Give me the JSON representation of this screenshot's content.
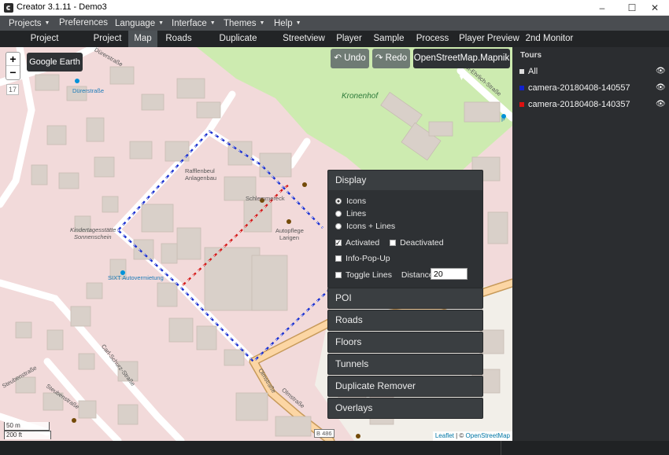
{
  "window": {
    "title": "Creator 3.1.11 - Demo3",
    "minimize": "–",
    "maximize": "☐",
    "close": "✕"
  },
  "menubar": [
    {
      "label": "Projects",
      "dropdown": true
    },
    {
      "label": "Preferences",
      "dropdown": false
    },
    {
      "label": "Language",
      "dropdown": true
    },
    {
      "label": "Interface",
      "dropdown": true
    },
    {
      "label": "Themes",
      "dropdown": true
    },
    {
      "label": "Help",
      "dropdown": true
    }
  ],
  "caret": "▼",
  "tabs": [
    {
      "label": "Project Management"
    },
    {
      "label": "Project"
    },
    {
      "label": "Map",
      "active": true
    },
    {
      "label": "Roads"
    },
    {
      "label": "Duplicate Remover"
    },
    {
      "label": "Streetview"
    },
    {
      "label": "Player"
    },
    {
      "label": "Sample"
    },
    {
      "label": "Process"
    },
    {
      "label": "Player Preview"
    },
    {
      "label": "2nd Monitor"
    }
  ],
  "map": {
    "zoom_in": "+",
    "zoom_out": "−",
    "zoom_level": "17",
    "google_earth": "Google Earth",
    "undo": "↶ Undo",
    "redo": "↷ Redo",
    "tile_layer": "OpenStreetMap.Mapnik ▾",
    "scale_metric": "50 m",
    "scale_imperial": "200 ft",
    "attribution_leaflet": "Leaflet",
    "attribution_sep": " | © ",
    "attribution_osm": "OpenStreetMap",
    "labels": {
      "kronenhof": "Kronenhof",
      "durerstrasse": "Dürerstraße",
      "durerstrasse2": "Dürerstraße",
      "rafflenbeul": "Rafflenbeul",
      "anlagenbau": "Anlagenbau",
      "schlemmer": "Schlemmereck",
      "autopflege": "Autopflege",
      "larigen": "Larigen",
      "kita1": "Kindertagesstätte",
      "kita2": "Sonnenschein",
      "sixt": "SIXT Autovermietung",
      "carl_schurz": "Carl-Schurz-Straße",
      "steuben": "Steubenstraße",
      "steuben2": "Steubenstraße",
      "olmstrasse": "Olmstraße",
      "olmstrasse2": "Olmstraße",
      "paul_ehrlich": "Paul-Ehrlich-Straße",
      "b486": "B 486",
      "park": "P"
    }
  },
  "display_panel": {
    "title": "Display",
    "options": [
      "Icons",
      "Lines",
      "Icons + Lines"
    ],
    "selected": "Icons",
    "activated": "Activated",
    "deactivated": "Deactivated",
    "info_popup": "Info-Pop-Up",
    "toggle_lines": "Toggle Lines",
    "distance_label": "Distance",
    "distance_value": "20"
  },
  "collapsed_panels": [
    "POI",
    "Roads",
    "Floors",
    "Tunnels",
    "Duplicate Remover",
    "Overlays"
  ],
  "tours": {
    "title": "Tours",
    "items": [
      {
        "label": "All",
        "color": "#dddddd"
      },
      {
        "label": "camera-20180408-140557",
        "color": "#1122cc"
      },
      {
        "label": "camera-20180408-140357",
        "color": "#dd1111"
      }
    ],
    "eye_icon": "👁"
  },
  "colors": {
    "route_blue": "#1a2fd0",
    "route_red": "#d41a1a",
    "park_green": "#cdebb0",
    "residential": "#f2dada",
    "building": "#d9d0c9"
  }
}
